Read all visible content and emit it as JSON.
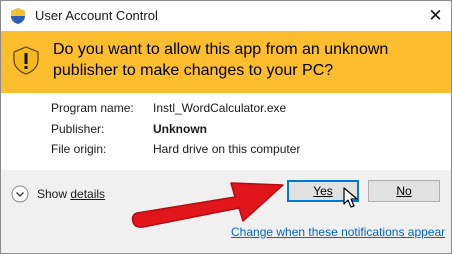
{
  "window": {
    "title": "User Account Control",
    "close_glyph": "✕"
  },
  "banner": {
    "icon": "shield-warning-icon",
    "question": "Do you want to allow this app from an unknown publisher to make changes to your PC?",
    "color": "#fcbd2e"
  },
  "info": {
    "program_label": "Program name:",
    "program_value": "Instl_WordCalculator.exe",
    "publisher_label": "Publisher:",
    "publisher_value": "Unknown",
    "origin_label": "File origin:",
    "origin_value": "Hard drive on this computer"
  },
  "footer": {
    "show_details_prefix": "Show ",
    "show_details_suffix": "details",
    "yes_label": "Yes",
    "no_label": "No",
    "notifications_link": "Change when these notifications appear"
  },
  "annotation": {
    "arrow_color": "#e0161b",
    "arrow_icon": "red-arrow-icon",
    "cursor_icon": "mouse-pointer-icon"
  }
}
